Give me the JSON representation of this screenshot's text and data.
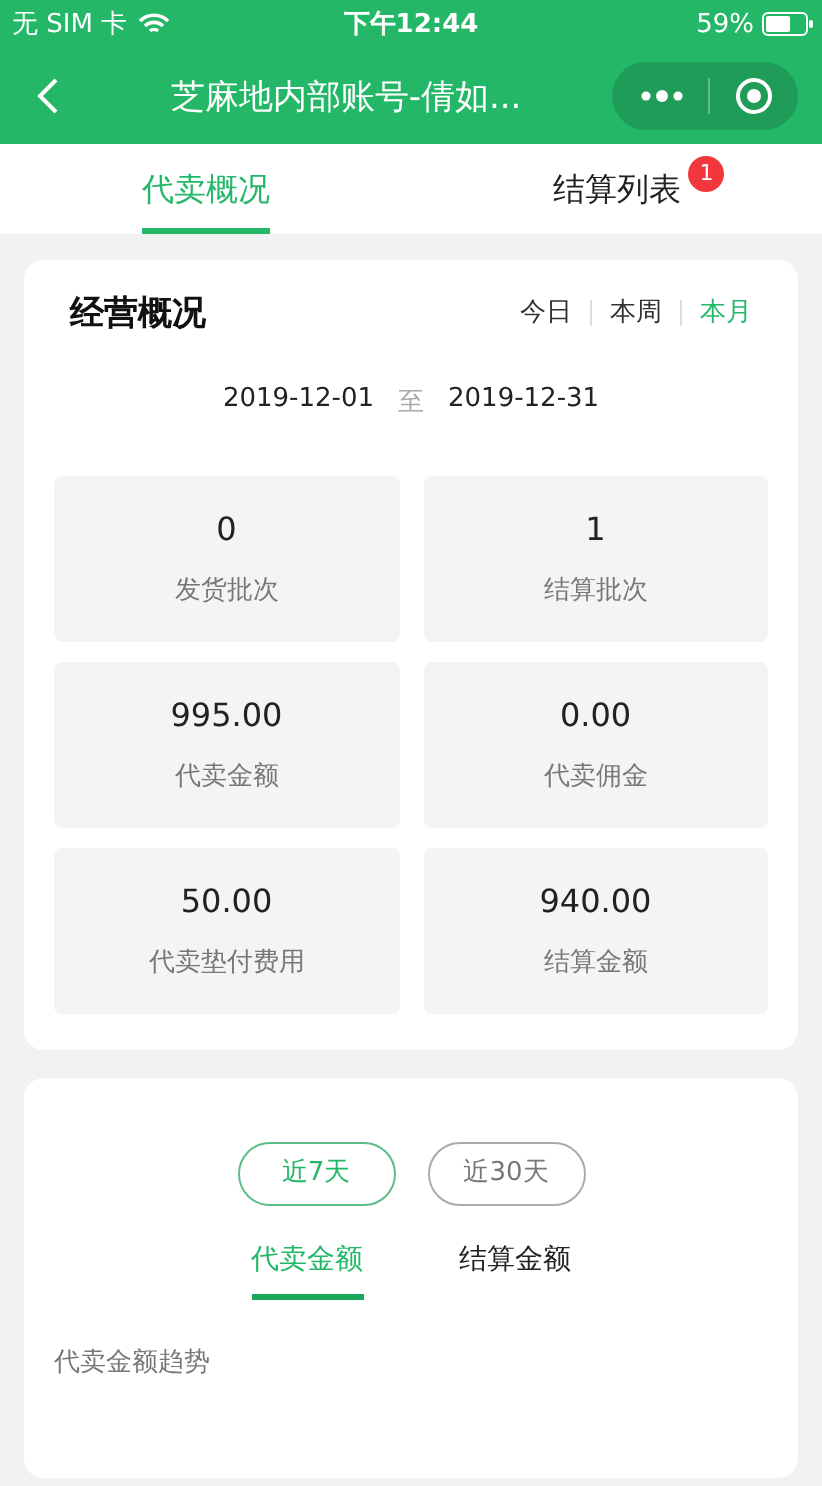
{
  "status_bar": {
    "carrier": "无 SIM 卡",
    "time": "下午12:44",
    "battery": "59%"
  },
  "nav": {
    "title": "芝麻地内部账号-倩如..."
  },
  "tabs": [
    {
      "label": "代卖概况",
      "selected": true
    },
    {
      "label": "结算列表",
      "selected": false,
      "badge": "1"
    }
  ],
  "overview": {
    "title": "经营概况",
    "periods": [
      {
        "label": "今日",
        "selected": false
      },
      {
        "label": "本周",
        "selected": false
      },
      {
        "label": "本月",
        "selected": true
      }
    ],
    "date_from": "2019-12-01",
    "date_sep": "至",
    "date_to": "2019-12-31",
    "stats": [
      {
        "value": "0",
        "label": "发货批次"
      },
      {
        "value": "1",
        "label": "结算批次"
      },
      {
        "value": "995.00",
        "label": "代卖金额"
      },
      {
        "value": "0.00",
        "label": "代卖佣金"
      },
      {
        "value": "50.00",
        "label": "代卖垫付费用"
      },
      {
        "value": "940.00",
        "label": "结算金额"
      }
    ]
  },
  "trend": {
    "ranges": [
      {
        "label": "近7天",
        "selected": true
      },
      {
        "label": "近30天",
        "selected": false
      }
    ],
    "tabs": [
      {
        "label": "代卖金额",
        "selected": true
      },
      {
        "label": "结算金额",
        "selected": false
      }
    ],
    "subtitle": "代卖金额趋势"
  }
}
